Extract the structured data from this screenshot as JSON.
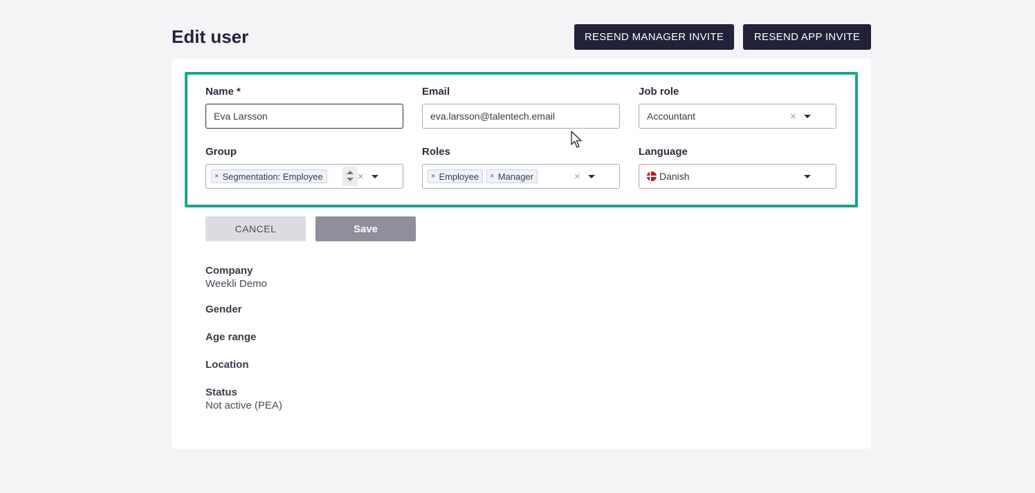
{
  "header": {
    "title": "Edit user",
    "resend_manager_label": "RESEND MANAGER INVITE",
    "resend_app_label": "RESEND APP INVITE"
  },
  "form": {
    "name": {
      "label": "Name *",
      "value": "Eva Larsson"
    },
    "email": {
      "label": "Email",
      "value": "eva.larsson@talentech.email"
    },
    "job_role": {
      "label": "Job role",
      "value": "Accountant"
    },
    "group": {
      "label": "Group",
      "chips": [
        "Segmentation: Employee"
      ]
    },
    "roles": {
      "label": "Roles",
      "chips": [
        "Employee",
        "Manager"
      ]
    },
    "language": {
      "label": "Language",
      "value": "Danish",
      "flag_icon": "denmark-flag-icon"
    }
  },
  "actions": {
    "cancel_label": "CANCEL",
    "save_label": "Save"
  },
  "details": {
    "company_label": "Company",
    "company_value": "Weekli Demo",
    "gender_label": "Gender",
    "age_range_label": "Age range",
    "location_label": "Location",
    "status_label": "Status",
    "status_value": "Not active (PEA)"
  },
  "colors": {
    "highlight": "#17a58a",
    "dark_button": "#21213a",
    "save_button": "#8e8e9c"
  }
}
